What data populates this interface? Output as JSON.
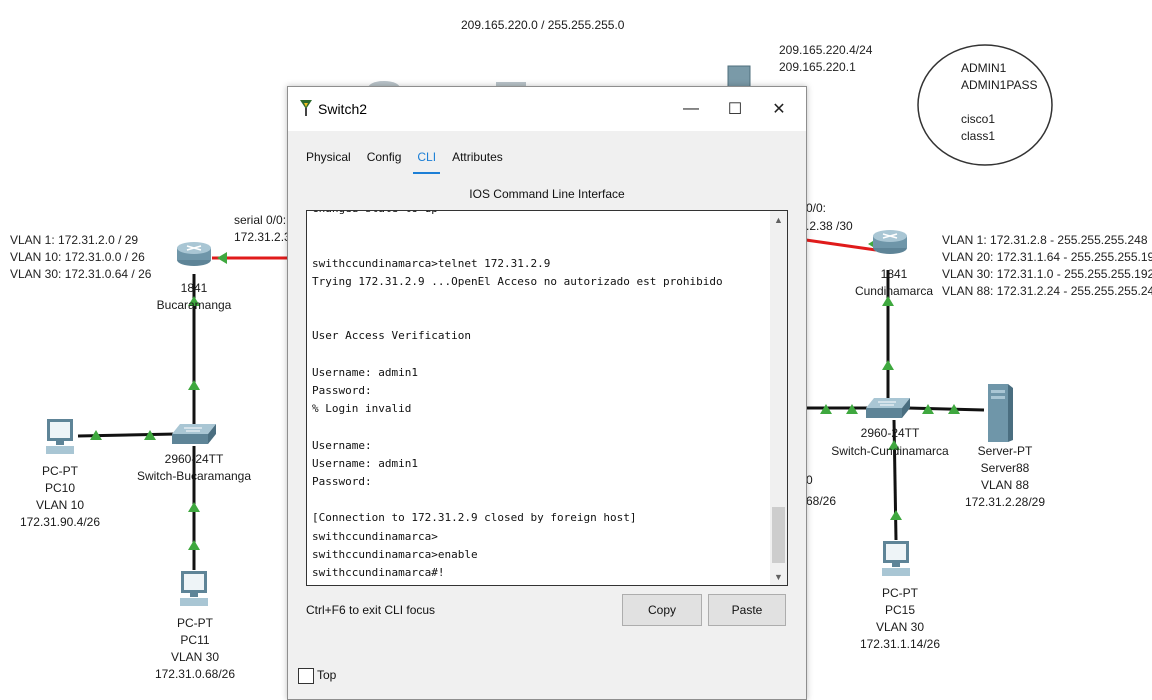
{
  "topology": {
    "top_network": "209.165.220.0 / 255.255.255.0",
    "server_ip_note": [
      "209.165.220.4/24",
      "209.165.220.1"
    ],
    "credentials": [
      "ADMIN1",
      "ADMIN1PASS",
      "",
      "cisco1",
      "class1"
    ],
    "bucaramanga": {
      "vlans": [
        "VLAN 1: 172.31.2.0 / 29",
        "VLAN 10: 172.31.0.0 / 26",
        "VLAN 30: 172.31.0.64 / 26"
      ],
      "serial_label": "serial 0/0:",
      "serial_ip": "172.31.2.3",
      "router_model": "1841",
      "router_name": "Bucaramanga",
      "switch_model": "2960-24TT",
      "switch_name": "Switch-Bucaramanga",
      "pc10": [
        "PC-PT",
        "PC10",
        "VLAN 10",
        "172.31.90.4/26"
      ],
      "pc11": [
        "PC-PT",
        "PC11",
        "VLAN 30",
        "172.31.0.68/26"
      ]
    },
    "cundinamarca": {
      "serial_label": "0/0:",
      "serial_ip": ".2.38 /30",
      "router_model": "1841",
      "router_name": "Cundinamarca",
      "vlans": [
        "VLAN 1: 172.31.2.8 - 255.255.255.248",
        "VLAN 20: 172.31.1.64 - 255.255.255.192",
        "VLAN 30: 172.31.1.0 - 255.255.255.192",
        "VLAN 88: 172.31.2.24 - 255.255.255.248"
      ],
      "switch_model": "2960-24TT",
      "switch_name": "Switch-Cundinamarca",
      "server": [
        "Server-PT",
        "Server88",
        "VLAN 88",
        "172.31.2.28/29"
      ],
      "pc15": [
        "PC-PT",
        "PC15",
        "VLAN 30",
        "172.31.1.14/26"
      ],
      "partial_pc": [
        "0",
        "68/26"
      ]
    }
  },
  "window": {
    "title": "Switch2",
    "tabs": [
      "Physical",
      "Config",
      "CLI",
      "Attributes"
    ],
    "active_tab": "CLI",
    "panel_title": "IOS Command Line Interface",
    "cli_lines": [
      "changed state to up",
      "",
      "",
      "swithccundinamarca>telnet 172.31.2.9",
      "Trying 172.31.2.9 ...OpenEl Acceso no autorizado est prohibido",
      "",
      "",
      "User Access Verification",
      "",
      "Username: admin1",
      "Password:",
      "% Login invalid",
      "",
      "Username:",
      "Username: admin1",
      "Password:",
      "",
      "[Connection to 172.31.2.9 closed by foreign host]",
      "swithccundinamarca>",
      "swithccundinamarca>enable",
      "swithccundinamarca#!"
    ],
    "hint": "Ctrl+F6 to exit CLI focus",
    "copy_label": "Copy",
    "paste_label": "Paste",
    "top_label": "Top",
    "minimize_glyph": "—",
    "maximize_glyph": "☐",
    "close_glyph": "✕",
    "scroll_up_glyph": "▲",
    "scroll_down_glyph": "▼"
  },
  "colors": {
    "serial_link": "#e01b1b",
    "link": "#111111",
    "link_arrow": "#3fa83f",
    "accent": "#1c7fd6"
  }
}
